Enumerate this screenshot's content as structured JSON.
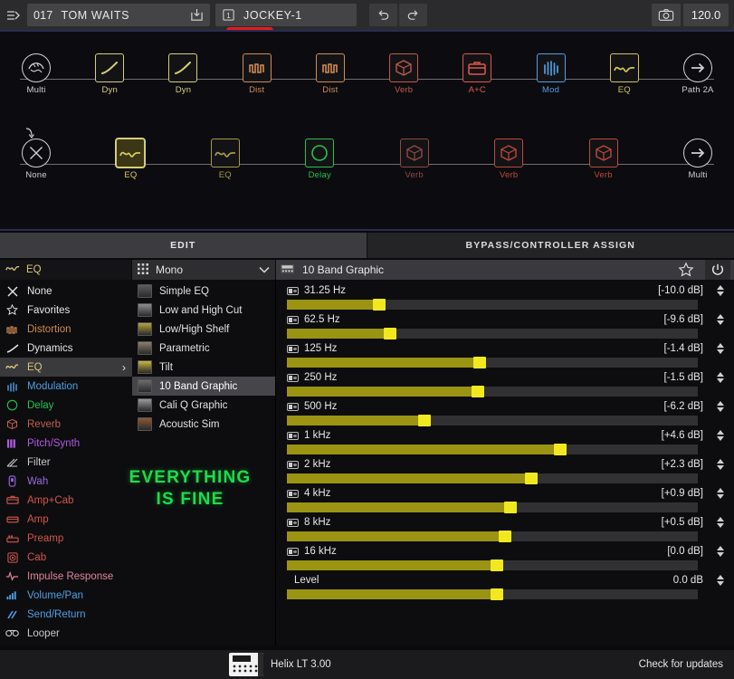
{
  "topbar": {
    "menu_icon": "hamburger-arrow-icon",
    "preset_number": "017",
    "preset_name": "TOM WAITS",
    "export_icon": "export-icon",
    "block_icon": "block-1-icon",
    "block_name": "JOCKEY-1",
    "undo_icon": "undo-icon",
    "redo_icon": "redo-icon",
    "camera_icon": "camera-icon",
    "tempo": "120.0",
    "accent_red": "#e51c1c"
  },
  "signal_flow": {
    "row1": [
      {
        "label": "Multi",
        "type": "input-round",
        "color": "#cfcfcf",
        "selected": false
      },
      {
        "label": "Dyn",
        "type": "dynamics",
        "color": "#d6cf7a",
        "selected": false
      },
      {
        "label": "Dyn",
        "type": "dynamics",
        "color": "#d6cf7a",
        "selected": false
      },
      {
        "label": "Dist",
        "type": "distortion",
        "color": "#d08b52",
        "selected": false
      },
      {
        "label": "Dist",
        "type": "distortion",
        "color": "#d08b52",
        "selected": false
      },
      {
        "label": "Verb",
        "type": "reverb",
        "color": "#c05a4a",
        "selected": false
      },
      {
        "label": "A+C",
        "type": "ampcab",
        "color": "#e0564e",
        "selected": false
      },
      {
        "label": "Mod",
        "type": "modulation",
        "color": "#4f9fe0",
        "selected": false
      },
      {
        "label": "EQ",
        "type": "eq",
        "color": "#cfc45a",
        "selected": false
      },
      {
        "label": "Path 2A",
        "type": "output-round",
        "color": "#cfcfcf",
        "selected": false
      }
    ],
    "row2": [
      {
        "label": "None",
        "type": "none-round",
        "color": "#cfcfcf",
        "selected": false
      },
      {
        "label": "EQ",
        "type": "eq",
        "color": "#d8cc5e",
        "selected": true
      },
      {
        "label": "EQ",
        "type": "eq",
        "color": "#a89a45",
        "selected": false
      },
      {
        "label": "Delay",
        "type": "delay",
        "color": "#24c24e",
        "selected": false
      },
      {
        "label": "Verb",
        "type": "reverb",
        "color": "#8d4a3e",
        "selected": false
      },
      {
        "label": "Verb",
        "type": "reverb",
        "color": "#c0483a",
        "selected": false
      },
      {
        "label": "Verb",
        "type": "reverb",
        "color": "#c0483a",
        "selected": false
      },
      {
        "label": "Multi",
        "type": "output-round",
        "color": "#cfcfcf",
        "selected": false
      }
    ]
  },
  "tabs": [
    {
      "label": "EDIT",
      "active": true
    },
    {
      "label": "BYPASS/CONTROLLER ASSIGN",
      "active": false
    }
  ],
  "subheader": {
    "category_icon": "eq-curve-icon",
    "category_label": "EQ",
    "grid_icon": "grid-icon",
    "channel_label": "Mono",
    "chevron_icon": "chevron-down-icon",
    "model_icon": "pedal-icon",
    "model_title": "10 Band Graphic",
    "favorite_icon": "star-icon",
    "power_icon": "power-icon"
  },
  "categories": [
    {
      "label": "None",
      "icon": "close-x-icon",
      "color": "#e8e8e8",
      "active": false
    },
    {
      "label": "Favorites",
      "icon": "star-icon",
      "color": "#e8e8e8",
      "active": false
    },
    {
      "label": "Distortion",
      "icon": "distortion-icon",
      "color": "#d08b52",
      "active": false
    },
    {
      "label": "Dynamics",
      "icon": "dynamics-icon",
      "color": "#e6e6e6",
      "active": false
    },
    {
      "label": "EQ",
      "icon": "eq-curve-icon",
      "color": "#d9c47a",
      "active": true
    },
    {
      "label": "Modulation",
      "icon": "modulation-icon",
      "color": "#4f9fe0",
      "active": false
    },
    {
      "label": "Delay",
      "icon": "delay-icon",
      "color": "#24c24e",
      "active": false
    },
    {
      "label": "Reverb",
      "icon": "reverb-icon",
      "color": "#c0604a",
      "active": false
    },
    {
      "label": "Pitch/Synth",
      "icon": "pitch-synth-icon",
      "color": "#b05ae0",
      "active": false
    },
    {
      "label": "Filter",
      "icon": "filter-icon",
      "color": "#c9c9c9",
      "active": false
    },
    {
      "label": "Wah",
      "icon": "wah-icon",
      "color": "#9a6ae0",
      "active": false
    },
    {
      "label": "Amp+Cab",
      "icon": "amp-cab-icon",
      "color": "#d4564a",
      "active": false
    },
    {
      "label": "Amp",
      "icon": "amp-icon",
      "color": "#d4564a",
      "active": false
    },
    {
      "label": "Preamp",
      "icon": "preamp-icon",
      "color": "#d4564a",
      "active": false
    },
    {
      "label": "Cab",
      "icon": "cab-icon",
      "color": "#d4564a",
      "active": false
    },
    {
      "label": "Impulse Response",
      "icon": "impulse-response-icon",
      "color": "#e0849a",
      "active": false
    },
    {
      "label": "Volume/Pan",
      "icon": "volume-pan-icon",
      "color": "#4f9fe0",
      "active": false
    },
    {
      "label": "Send/Return",
      "icon": "send-return-icon",
      "color": "#4f9fe0",
      "active": false
    },
    {
      "label": "Looper",
      "icon": "looper-icon",
      "color": "#c9c9c9",
      "active": false
    }
  ],
  "models": [
    {
      "label": "Simple EQ",
      "active": false,
      "swatch": "#5c5c5c"
    },
    {
      "label": "Low and High Cut",
      "active": false,
      "swatch": "#8d8d8d"
    },
    {
      "label": "Low/High Shelf",
      "active": false,
      "swatch": "#b5a53d"
    },
    {
      "label": "Parametric",
      "active": false,
      "swatch": "#8a7f6a"
    },
    {
      "label": "Tilt",
      "active": false,
      "swatch": "#c8b63f"
    },
    {
      "label": "10 Band Graphic",
      "active": true,
      "swatch": "#6d6d6d"
    },
    {
      "label": "Cali Q Graphic",
      "active": false,
      "swatch": "#9a9a9a"
    },
    {
      "label": "Acoustic Sim",
      "active": false,
      "swatch": "#8a5a33"
    }
  ],
  "overlay_text": {
    "line1": "EVERYTHING",
    "line2": "IS FINE",
    "color": "#1edc4a"
  },
  "eq": {
    "model_title": "10 Band Graphic",
    "bands": [
      {
        "label": "31.25 Hz",
        "value": "[-10.0 dB]",
        "fill_pct": 22.5,
        "assignable": true
      },
      {
        "label": "62.5 Hz",
        "value": "[-9.6 dB]",
        "fill_pct": 25.0,
        "assignable": true
      },
      {
        "label": "125 Hz",
        "value": "[-1.4 dB]",
        "fill_pct": 47.0,
        "assignable": true
      },
      {
        "label": "250 Hz",
        "value": "[-1.5 dB]",
        "fill_pct": 46.5,
        "assignable": true
      },
      {
        "label": "500 Hz",
        "value": "[-6.2 dB]",
        "fill_pct": 33.5,
        "assignable": true
      },
      {
        "label": "1 kHz",
        "value": "[+4.6 dB]",
        "fill_pct": 66.5,
        "assignable": true
      },
      {
        "label": "2 kHz",
        "value": "[+2.3 dB]",
        "fill_pct": 59.5,
        "assignable": true
      },
      {
        "label": "4 kHz",
        "value": "[+0.9 dB]",
        "fill_pct": 54.5,
        "assignable": true
      },
      {
        "label": "8 kHz",
        "value": "[+0.5 dB]",
        "fill_pct": 53.0,
        "assignable": true
      },
      {
        "label": "16 kHz",
        "value": "[0.0 dB]",
        "fill_pct": 51.0,
        "assignable": true
      },
      {
        "label": "Level",
        "value": "0.0 dB",
        "fill_pct": 51.0,
        "assignable": false
      }
    ]
  },
  "statusbar": {
    "device_icon": "helix-device-icon",
    "device_name": "Helix LT 3.00",
    "update_label": "Check for updates"
  }
}
